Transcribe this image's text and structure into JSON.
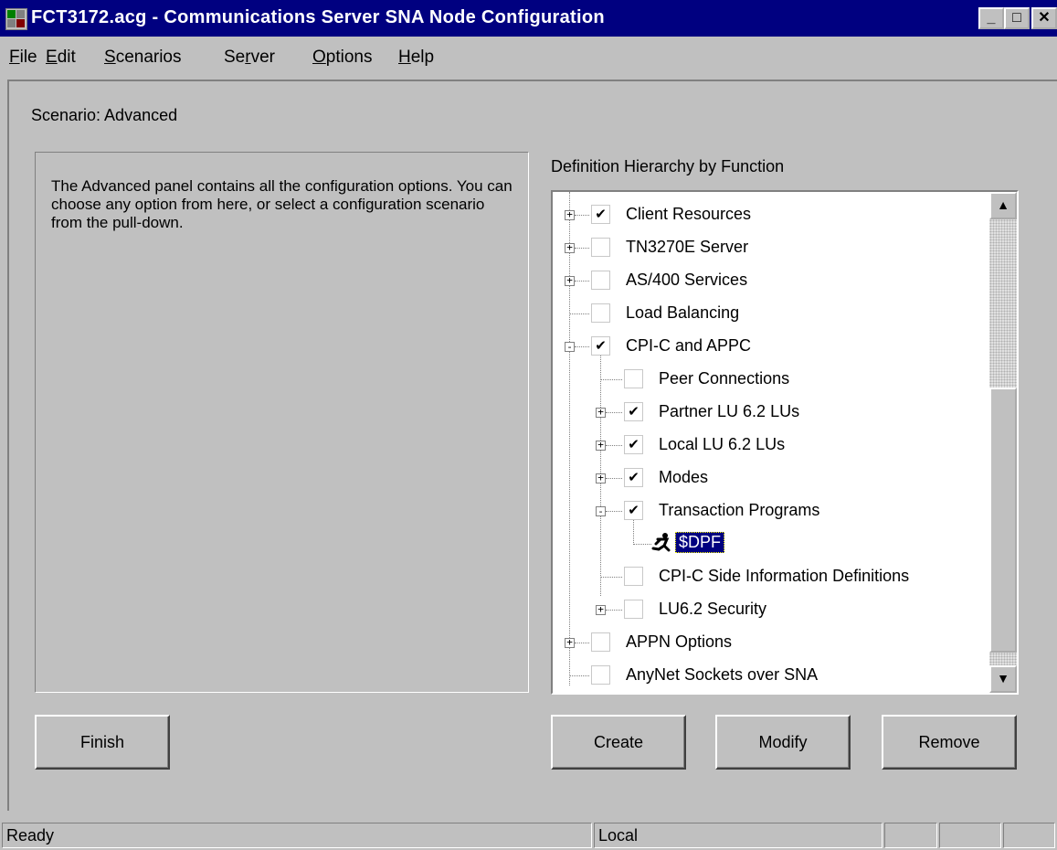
{
  "window": {
    "title": "FCT3172.acg - Communications Server SNA Node Configuration",
    "minimize_glyph": "_",
    "maximize_glyph": "□",
    "close_glyph": "✕"
  },
  "menu": {
    "items": [
      {
        "label": "File",
        "mnemonic": "F"
      },
      {
        "label": "Edit",
        "mnemonic": "E"
      },
      {
        "label": "Scenarios",
        "mnemonic": "S"
      },
      {
        "label": "Server",
        "mnemonic": "r"
      },
      {
        "label": "Options",
        "mnemonic": "O"
      },
      {
        "label": "Help",
        "mnemonic": "H"
      }
    ]
  },
  "scenario": {
    "label": "Scenario: Advanced"
  },
  "description": {
    "text": "The Advanced panel contains all the configuration options. You can choose any option from here, or select a configuration scenario from the pull-down."
  },
  "hierarchy": {
    "label": "Definition Hierarchy by Function",
    "items": [
      {
        "label": "Client Resources",
        "checked": true,
        "expander": "+",
        "level": 0
      },
      {
        "label": "TN3270E Server",
        "checked": false,
        "expander": "+",
        "level": 0
      },
      {
        "label": "AS/400 Services",
        "checked": false,
        "expander": "+",
        "level": 0
      },
      {
        "label": "Load Balancing",
        "checked": false,
        "expander": "",
        "level": 0
      },
      {
        "label": "CPI-C and APPC",
        "checked": true,
        "expander": "-",
        "level": 0
      },
      {
        "label": "Peer Connections",
        "checked": false,
        "expander": "",
        "level": 1
      },
      {
        "label": "Partner LU 6.2 LUs",
        "checked": true,
        "expander": "+",
        "level": 1
      },
      {
        "label": "Local LU 6.2 LUs",
        "checked": true,
        "expander": "+",
        "level": 1
      },
      {
        "label": "Modes",
        "checked": true,
        "expander": "+",
        "level": 1
      },
      {
        "label": "Transaction Programs",
        "checked": true,
        "expander": "-",
        "level": 1
      },
      {
        "label": "$DPF",
        "icon": "running-person-icon",
        "selected": true,
        "level": 2
      },
      {
        "label": "CPI-C Side Information Definitions",
        "checked": false,
        "expander": "",
        "level": 1
      },
      {
        "label": "LU6.2 Security",
        "checked": false,
        "expander": "+",
        "level": 1
      },
      {
        "label": "APPN Options",
        "checked": false,
        "expander": "+",
        "level": 0
      },
      {
        "label": "AnyNet Sockets over SNA",
        "checked": false,
        "expander": "",
        "level": 0
      }
    ],
    "check_glyph": "✔",
    "scroll_up_glyph": "▲",
    "scroll_down_glyph": "▼"
  },
  "buttons": {
    "finish": "Finish",
    "create": "Create",
    "modify": "Modify",
    "remove": "Remove"
  },
  "status": {
    "message": "Ready",
    "location": "Local"
  },
  "colors": {
    "titlebar": "#000080",
    "face": "#c0c0c0",
    "selection": "#000080"
  }
}
